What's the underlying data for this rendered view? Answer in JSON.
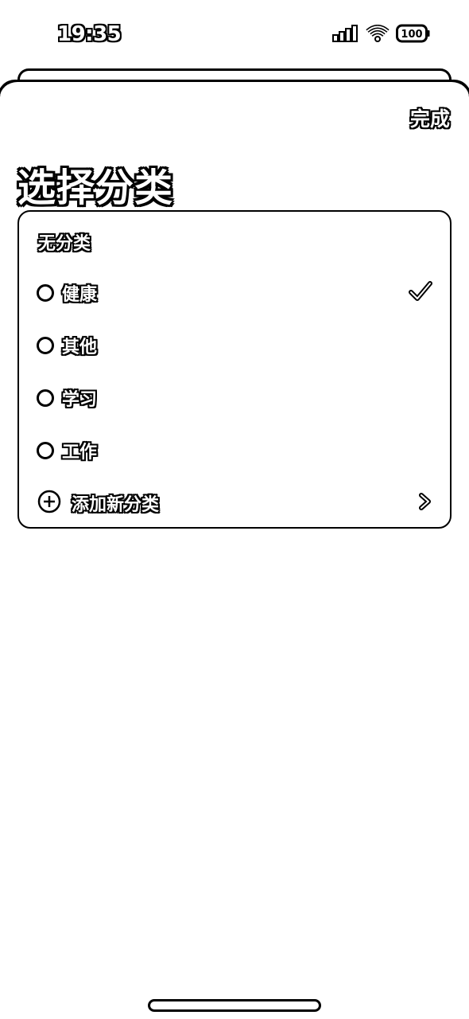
{
  "status_bar": {
    "time": "19:35",
    "battery": "100"
  },
  "header": {
    "done_label": "完成"
  },
  "title": "选择分类",
  "card": {
    "heading": "无分类",
    "items": [
      {
        "label": "健康",
        "selected": true
      },
      {
        "label": "其他",
        "selected": false
      },
      {
        "label": "学习",
        "selected": false
      },
      {
        "label": "工作",
        "selected": false
      }
    ],
    "add_label": "添加新分类"
  }
}
